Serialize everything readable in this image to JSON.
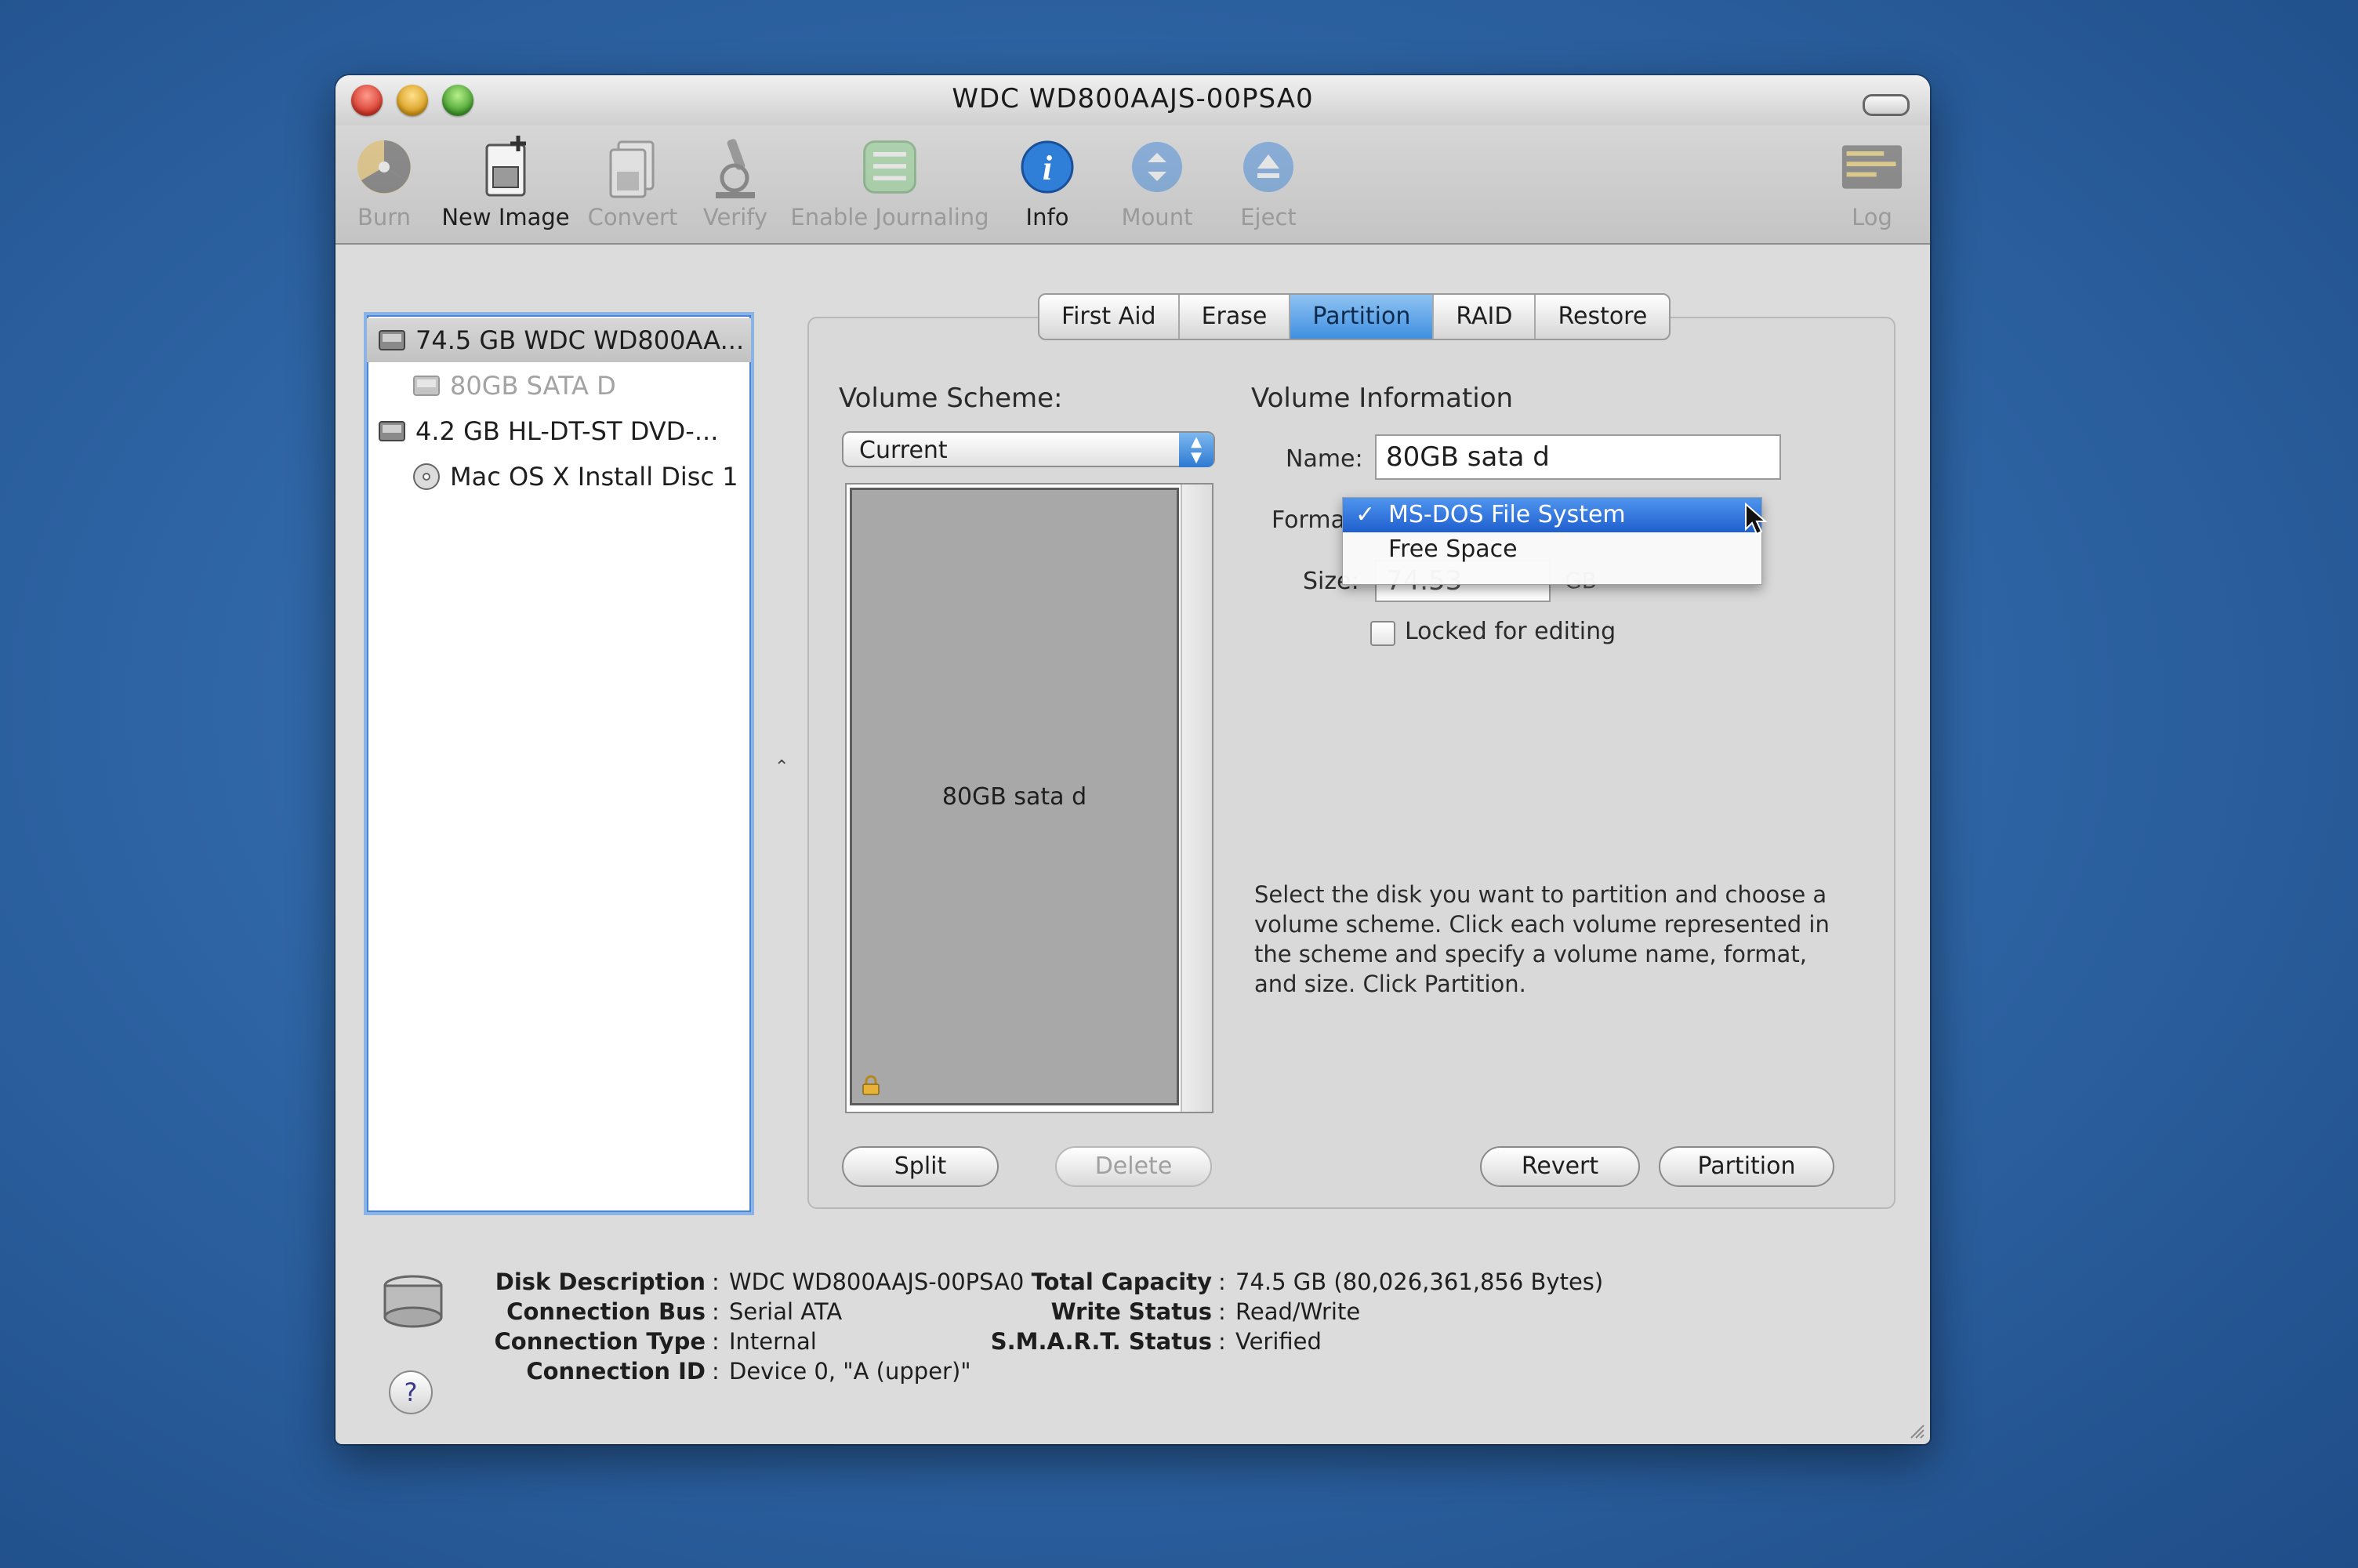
{
  "window": {
    "title": "WDC WD800AAJS-00PSA0"
  },
  "toolbar": {
    "items": [
      {
        "label": "Burn",
        "icon": "burn-icon",
        "enabled": false
      },
      {
        "label": "New Image",
        "icon": "new-image-icon",
        "enabled": true
      },
      {
        "label": "Convert",
        "icon": "convert-icon",
        "enabled": false
      },
      {
        "label": "Verify",
        "icon": "verify-icon",
        "enabled": false
      },
      {
        "label": "Enable Journaling",
        "icon": "journaling-icon",
        "enabled": false
      },
      {
        "label": "Info",
        "icon": "info-icon",
        "enabled": true
      },
      {
        "label": "Mount",
        "icon": "mount-icon",
        "enabled": false
      },
      {
        "label": "Eject",
        "icon": "eject-icon",
        "enabled": false
      },
      {
        "label": "Log",
        "icon": "log-icon",
        "enabled": false
      }
    ]
  },
  "sidebar": {
    "items": [
      {
        "label": "74.5 GB WDC WD800AA...",
        "icon": "hard-disk-icon",
        "selected": true,
        "dimmed": false
      },
      {
        "label": "80GB SATA D",
        "icon": "volume-icon",
        "selected": false,
        "dimmed": true
      },
      {
        "label": "4.2 GB HL-DT-ST DVD-...",
        "icon": "optical-drive-icon",
        "selected": false,
        "dimmed": false
      },
      {
        "label": "Mac OS X Install Disc 1",
        "icon": "disc-icon",
        "selected": false,
        "dimmed": false
      }
    ]
  },
  "tabs": [
    {
      "label": "First Aid",
      "active": false
    },
    {
      "label": "Erase",
      "active": false
    },
    {
      "label": "Partition",
      "active": true
    },
    {
      "label": "RAID",
      "active": false
    },
    {
      "label": "Restore",
      "active": false
    }
  ],
  "partition": {
    "volume_scheme_label": "Volume Scheme:",
    "volume_scheme_value": "Current",
    "scheme_volume_name": "80GB sata d",
    "volume_information_label": "Volume Information",
    "name_label": "Name:",
    "name_value": "80GB sata d",
    "format_label": "Format",
    "format_menu": {
      "options": [
        {
          "label": "MS-DOS File System",
          "checked": true
        },
        {
          "label": "Free Space",
          "checked": false
        }
      ],
      "check_mark": "✓"
    },
    "size_label": "Size:",
    "size_value": "74.53",
    "size_unit": "GB",
    "locked_label": "Locked for editing",
    "locked_checked": false,
    "help_text": "Select the disk you want to partition and choose a volume scheme. Click each volume represented in the scheme and specify a volume name, format, and size. Click Partition.",
    "buttons": {
      "split": "Split",
      "delete": "Delete",
      "revert": "Revert",
      "partition": "Partition"
    }
  },
  "disk_info": {
    "left": [
      {
        "key": "Disk Description",
        "value": "WDC WD800AAJS-00PSA0"
      },
      {
        "key": "Connection Bus",
        "value": "Serial ATA"
      },
      {
        "key": "Connection Type",
        "value": "Internal"
      },
      {
        "key": "Connection ID",
        "value": "Device 0, \"A (upper)\""
      }
    ],
    "right": [
      {
        "key": "Total Capacity",
        "value": "74.5 GB (80,026,361,856 Bytes)"
      },
      {
        "key": "Write Status",
        "value": "Read/Write"
      },
      {
        "key": "S.M.A.R.T. Status",
        "value": "Verified"
      }
    ],
    "separator": ":"
  },
  "help_button": "?",
  "colors": {
    "accent": "#3f8fe0",
    "menu_selection": "#1f5fcf",
    "desktop": "#2f66a6"
  }
}
